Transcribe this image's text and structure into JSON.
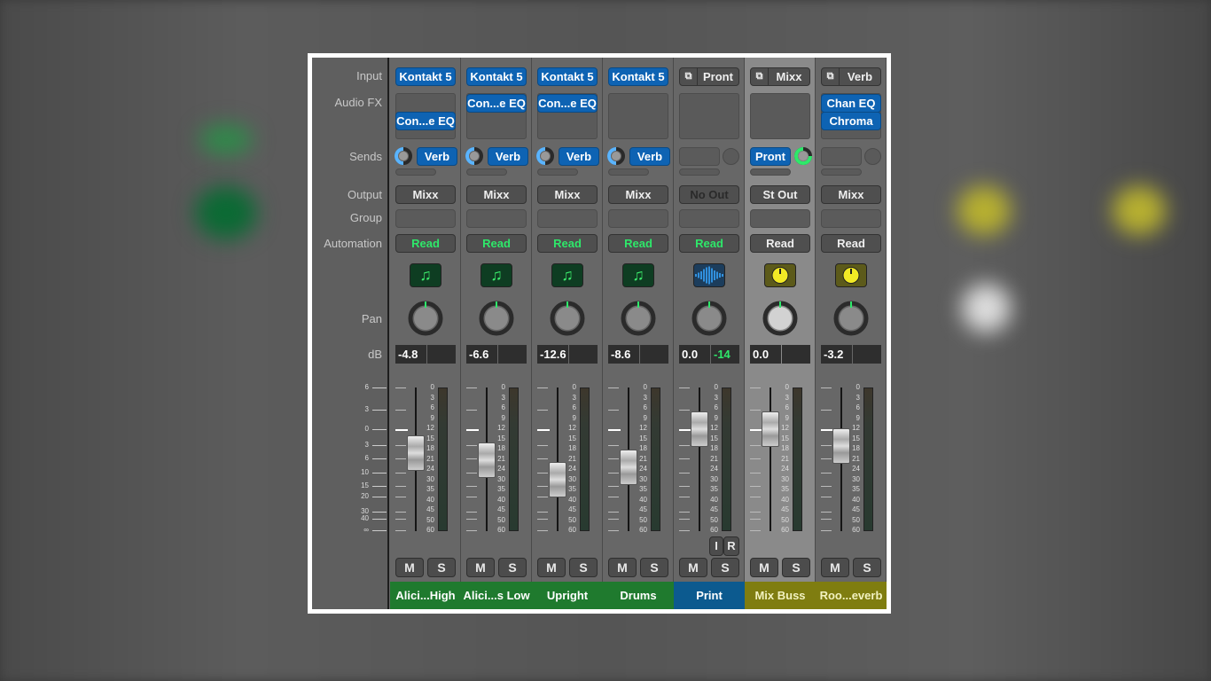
{
  "row_labels": {
    "input": "Input",
    "audio_fx": "Audio FX",
    "sends": "Sends",
    "output": "Output",
    "group": "Group",
    "automation": "Automation",
    "pan": "Pan",
    "db": "dB"
  },
  "fader_scale": [
    "6",
    "3",
    "0",
    "3",
    "6",
    "10",
    "15",
    "20",
    "30",
    "40",
    "∞"
  ],
  "meter_scale": [
    "0",
    "3",
    "6",
    "9",
    "12",
    "15",
    "18",
    "21",
    "24",
    "30",
    "35",
    "40",
    "45",
    "50",
    "60"
  ],
  "colors": {
    "audio": "#1f7a2e",
    "output": "#0c5a8f",
    "aux": "#7f7d10",
    "read": "#2ee86a",
    "send_knob": "#5ab4ff",
    "send_knob_active": "#2ee86a"
  },
  "channels": [
    {
      "name": "Alici...High",
      "type": "audio",
      "input": "Kontakt 5",
      "input_stereo": false,
      "fx": [
        "",
        "Con...e EQ"
      ],
      "send": "Verb",
      "send_side": "right",
      "output": "Mixx",
      "automation": "Read",
      "automation_green": true,
      "icon": "music-note-icon",
      "pan": 0,
      "volume": "-4.8",
      "peak": "",
      "fader_db": -4.8,
      "mute": "M",
      "solo": "S"
    },
    {
      "name": "Alici...s Low",
      "type": "audio",
      "input": "Kontakt 5",
      "input_stereo": false,
      "fx": [
        "Con...e EQ"
      ],
      "send": "Verb",
      "send_side": "right",
      "output": "Mixx",
      "automation": "Read",
      "automation_green": true,
      "icon": "music-note-icon",
      "pan": 0,
      "volume": "-6.6",
      "peak": "",
      "fader_db": -6.6,
      "mute": "M",
      "solo": "S"
    },
    {
      "name": "Upright",
      "type": "audio",
      "input": "Kontakt 5",
      "input_stereo": false,
      "fx": [
        "Con...e EQ"
      ],
      "send": "Verb",
      "send_side": "right",
      "output": "Mixx",
      "automation": "Read",
      "automation_green": true,
      "icon": "music-note-icon",
      "pan": 0,
      "volume": "-12.6",
      "peak": "",
      "fader_db": -12.6,
      "mute": "M",
      "solo": "S"
    },
    {
      "name": "Drums",
      "type": "audio",
      "input": "Kontakt 5",
      "input_stereo": false,
      "fx": [],
      "send": "Verb",
      "send_side": "right",
      "output": "Mixx",
      "automation": "Read",
      "automation_green": true,
      "icon": "music-note-icon",
      "pan": 0,
      "volume": "-8.6",
      "peak": "",
      "fader_db": -8.6,
      "mute": "M",
      "solo": "S"
    },
    {
      "name": "Print",
      "type": "output",
      "input": "Pront",
      "input_stereo": true,
      "fx": [],
      "send": "",
      "send_side": "",
      "output": "No Out",
      "automation": "Read",
      "automation_green": true,
      "icon": "waveform-icon",
      "pan": 0,
      "volume": "0.0",
      "peak": "-14",
      "fader_db": 0.0,
      "mute": "M",
      "solo": "S",
      "input_monitor": "I",
      "record": "R"
    },
    {
      "name": "Mix Buss",
      "type": "aux",
      "selected": true,
      "input": "Mixx",
      "input_stereo": true,
      "fx": [],
      "send": "Pront",
      "send_side": "left",
      "output": "St Out",
      "automation": "Read",
      "automation_green": false,
      "icon": "aux-knob-icon",
      "pan": 0,
      "volume": "0.0",
      "peak": "",
      "fader_db": 0.0,
      "mute": "M",
      "solo": "S"
    },
    {
      "name": "Roo...everb",
      "type": "aux",
      "input": "Verb",
      "input_stereo": true,
      "fx": [
        "Chan EQ",
        "Chroma"
      ],
      "send": "",
      "send_side": "",
      "output": "Mixx",
      "automation": "Read",
      "automation_green": false,
      "icon": "aux-knob-icon",
      "pan": 0,
      "volume": "-3.2",
      "peak": "",
      "fader_db": -3.2,
      "mute": "M",
      "solo": "S"
    }
  ]
}
